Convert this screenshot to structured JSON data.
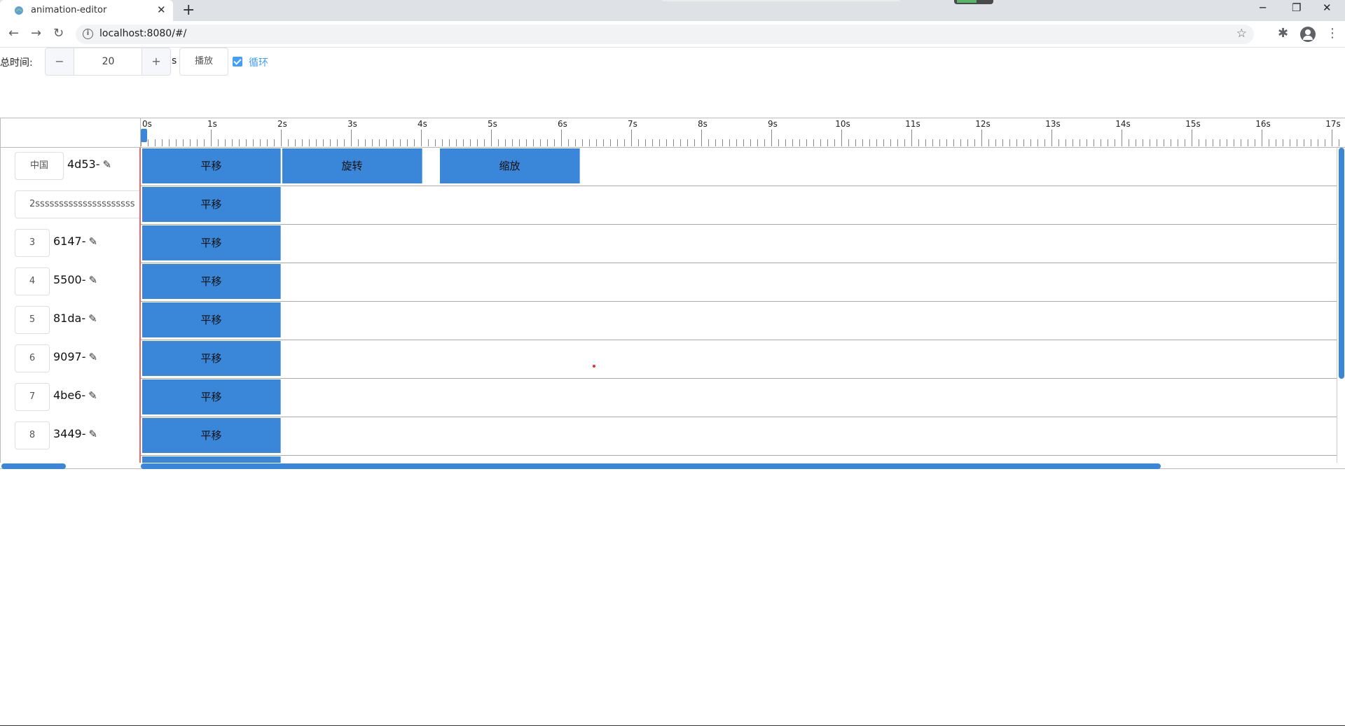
{
  "browser": {
    "tab_title": "animation-editor",
    "tab_close": "✕",
    "new_tab": "+",
    "url": "localhost:8080/#/",
    "controls": {
      "minimize": "─",
      "restore": "❐",
      "close": "✕"
    }
  },
  "toolbar": {
    "total_time_label": "总时间:",
    "minus": "−",
    "plus": "+",
    "duration_value": "20",
    "unit": "s",
    "play_label": "播放",
    "loop_label": "循环",
    "loop_checked": true
  },
  "ruler": {
    "ticks": [
      "0s",
      "1s",
      "2s",
      "3s",
      "4s",
      "5s",
      "6s",
      "7s",
      "8s",
      "9s",
      "10s",
      "11s",
      "12s",
      "13s",
      "14s",
      "15s",
      "16s",
      "17s"
    ]
  },
  "tracks": [
    {
      "input": "中国",
      "name": "4d53-",
      "clips": [
        {
          "label": "平移",
          "start": 0,
          "end": 2
        },
        {
          "label": "旋转",
          "start": 2,
          "end": 4
        },
        {
          "label": "缩放",
          "start": 4.25,
          "end": 6.25
        }
      ]
    },
    {
      "input": "2sssssssssssssssssssss",
      "name": "",
      "clips": [
        {
          "label": "平移",
          "start": 0,
          "end": 2
        }
      ]
    },
    {
      "input": "3",
      "name": "6147-",
      "clips": [
        {
          "label": "平移",
          "start": 0,
          "end": 2
        }
      ]
    },
    {
      "input": "4",
      "name": "5500-",
      "clips": [
        {
          "label": "平移",
          "start": 0,
          "end": 2
        }
      ]
    },
    {
      "input": "5",
      "name": "81da-",
      "clips": [
        {
          "label": "平移",
          "start": 0,
          "end": 2
        }
      ]
    },
    {
      "input": "6",
      "name": "9097-",
      "clips": [
        {
          "label": "平移",
          "start": 0,
          "end": 2
        }
      ]
    },
    {
      "input": "7",
      "name": "4be6-",
      "clips": [
        {
          "label": "平移",
          "start": 0,
          "end": 2
        }
      ]
    },
    {
      "input": "8",
      "name": "3449-",
      "clips": [
        {
          "label": "平移",
          "start": 0,
          "end": 2
        }
      ]
    }
  ],
  "colors": {
    "clip": "#3a86d8",
    "accent": "#409eff",
    "playhead": "#e66666"
  },
  "icons": {
    "edit": "pencil-icon"
  }
}
